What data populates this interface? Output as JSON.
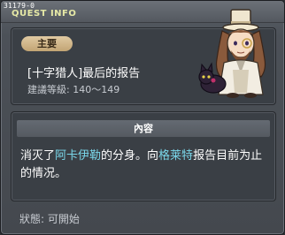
{
  "window": {
    "quest_id": "31179-0",
    "title": "QUEST INFO"
  },
  "quest": {
    "tag": "主要",
    "name": "[十字猎人]最后的报告",
    "level_label": "建議等級:",
    "level_range": "140～149"
  },
  "content": {
    "header": "內容",
    "text_1": "消灭了",
    "name_1": "阿卡伊勒",
    "text_2": "的分身。向",
    "name_2": "格莱特",
    "text_3": "报告目前为止的情况。"
  },
  "status": {
    "label": "狀態:",
    "value": "可開始"
  },
  "colors": {
    "highlight": "#7ad7ea",
    "title": "#e6e9a6",
    "tag_bg": "#d8be90"
  },
  "icons": {
    "npc": "npc-portrait-icon"
  }
}
